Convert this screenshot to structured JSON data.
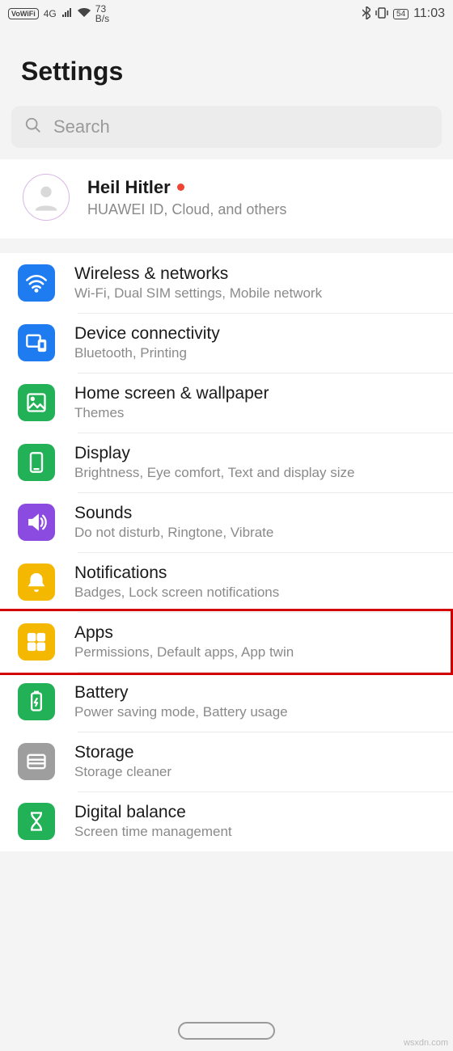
{
  "status": {
    "vowifi": "VoWiFi",
    "net_gen": "4G",
    "speed_top": "73",
    "speed_unit": "B/s",
    "battery": "54",
    "time": "11:03"
  },
  "header": {
    "title": "Settings"
  },
  "search": {
    "placeholder": "Search"
  },
  "account": {
    "name": "Heil Hitler",
    "sub": "HUAWEI ID, Cloud, and others"
  },
  "items": [
    {
      "id": "wireless",
      "title": "Wireless & networks",
      "sub": "Wi-Fi, Dual SIM settings, Mobile network",
      "color": "#1E7CF0"
    },
    {
      "id": "device-connectivity",
      "title": "Device connectivity",
      "sub": "Bluetooth, Printing",
      "color": "#1E7CF0"
    },
    {
      "id": "home-screen",
      "title": "Home screen & wallpaper",
      "sub": "Themes",
      "color": "#22B157"
    },
    {
      "id": "display",
      "title": "Display",
      "sub": "Brightness, Eye comfort, Text and display size",
      "color": "#22B157"
    },
    {
      "id": "sounds",
      "title": "Sounds",
      "sub": "Do not disturb, Ringtone, Vibrate",
      "color": "#8B4BE0"
    },
    {
      "id": "notifications",
      "title": "Notifications",
      "sub": "Badges, Lock screen notifications",
      "color": "#F5B800"
    },
    {
      "id": "apps",
      "title": "Apps",
      "sub": "Permissions, Default apps, App twin",
      "color": "#F5B800"
    },
    {
      "id": "battery",
      "title": "Battery",
      "sub": "Power saving mode, Battery usage",
      "color": "#22B157"
    },
    {
      "id": "storage",
      "title": "Storage",
      "sub": "Storage cleaner",
      "color": "#9E9E9E"
    },
    {
      "id": "digital-balance",
      "title": "Digital balance",
      "sub": "Screen time management",
      "color": "#22B157"
    }
  ],
  "highlighted_item": "apps",
  "watermark": "wsxdn.com"
}
